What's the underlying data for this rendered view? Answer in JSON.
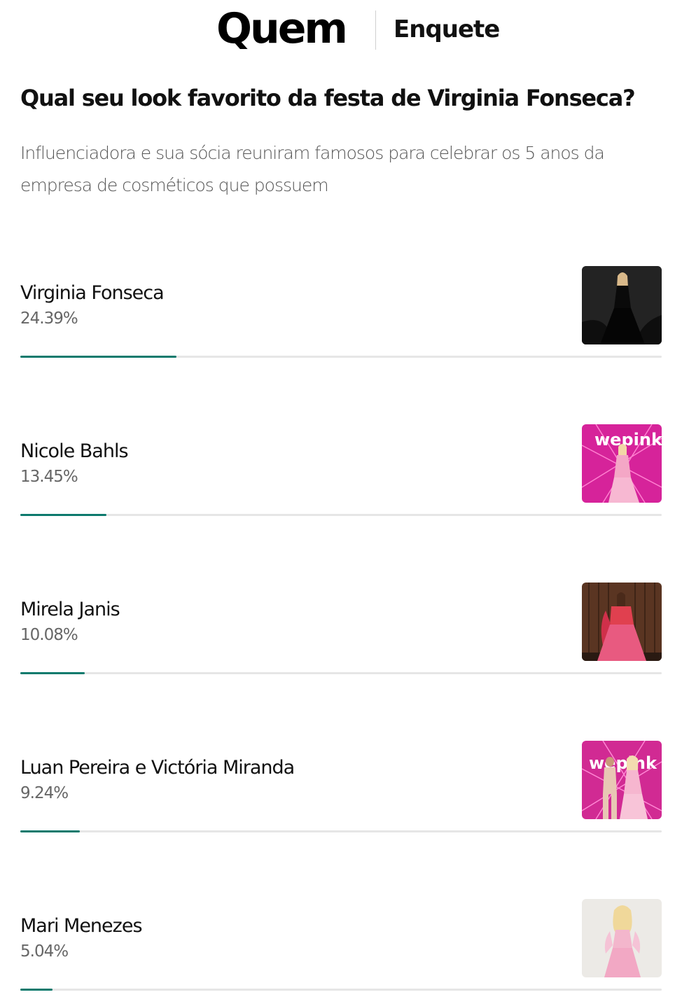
{
  "header": {
    "brand": "Quem",
    "section": "Enquete"
  },
  "poll": {
    "question": "Qual seu look favorito da festa de Virginia Fonseca?",
    "description": "Influenciadora e sua sócia reuniram famosos para celebrar os 5 anos da empresa de cosméticos que possuem",
    "accent_color": "#0d7a6d",
    "options": [
      {
        "name": "Virginia Fonseca",
        "percent_label": "24.39%",
        "percent": 24.39,
        "image_icon": "photo-black-gown"
      },
      {
        "name": "Nicole Bahls",
        "percent_label": "13.45%",
        "percent": 13.45,
        "image_icon": "photo-pink-backdrop"
      },
      {
        "name": "Mirela Janis",
        "percent_label": "10.08%",
        "percent": 10.08,
        "image_icon": "photo-pink-gown-wood-wall"
      },
      {
        "name": "Luan Pereira e Victória Miranda",
        "percent_label": "9.24%",
        "percent": 9.24,
        "image_icon": "photo-couple-pink-backdrop"
      },
      {
        "name": "Mari Menezes",
        "percent_label": "5.04%",
        "percent": 5.04,
        "image_icon": "photo-pink-dress-white-wall"
      }
    ]
  }
}
